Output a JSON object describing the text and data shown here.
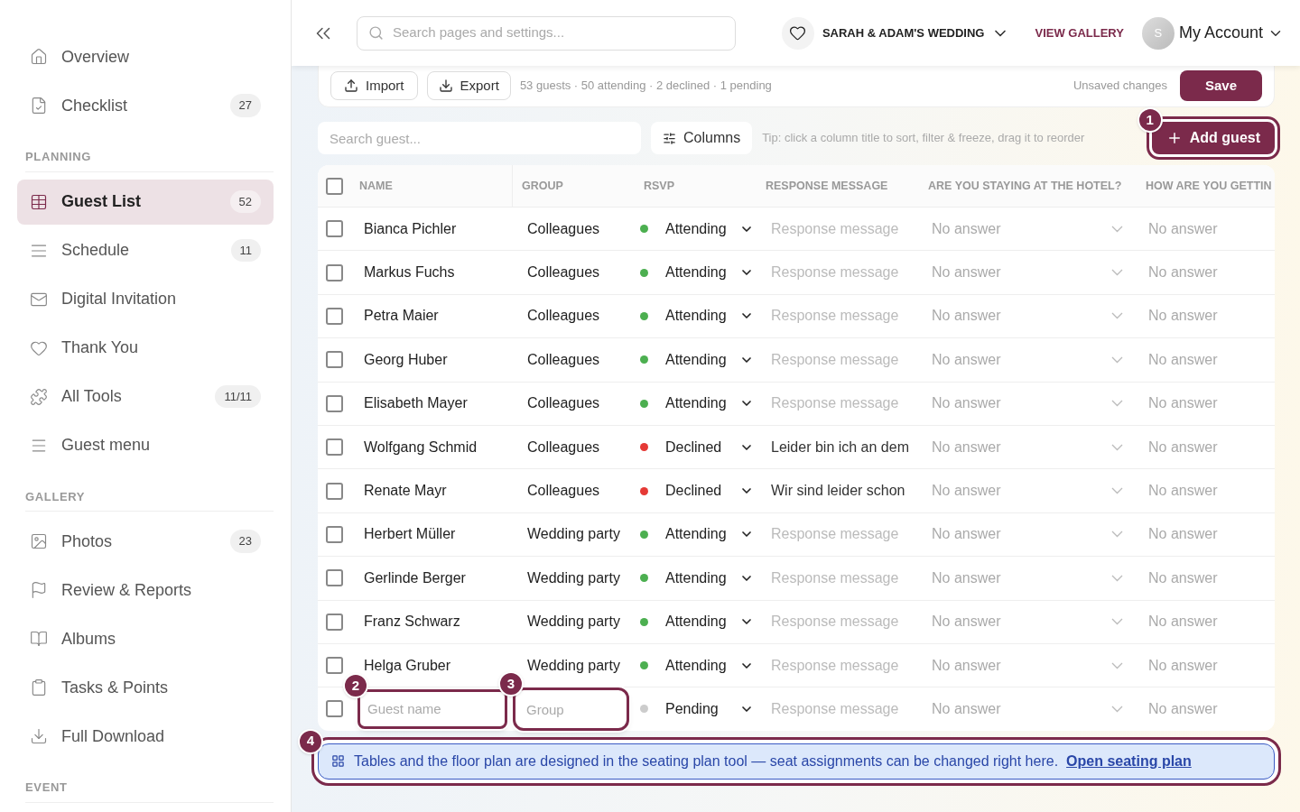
{
  "sidebar": {
    "sections": [
      {
        "items": [
          {
            "label": "Overview",
            "selected": false
          },
          {
            "label": "Checklist",
            "count": "27",
            "selected": false
          }
        ]
      },
      {
        "heading": "PLANNING",
        "items": [
          {
            "label": "Guest List",
            "count": "52",
            "selected": true
          },
          {
            "label": "Schedule",
            "count": "11",
            "selected": false
          },
          {
            "label": "Digital Invitation",
            "selected": false
          },
          {
            "label": "Thank You",
            "selected": false
          },
          {
            "label": "All Tools",
            "count": "11/11",
            "selected": false
          },
          {
            "label": "Guest menu",
            "selected": false
          }
        ]
      },
      {
        "heading": "GALLERY",
        "items": [
          {
            "label": "Photos",
            "count": "23",
            "selected": false
          },
          {
            "label": "Review & Reports",
            "selected": false
          },
          {
            "label": "Albums",
            "selected": false
          },
          {
            "label": "Tasks & Points",
            "selected": false
          },
          {
            "label": "Full Download",
            "selected": false
          }
        ]
      },
      {
        "heading": "EVENT"
      }
    ]
  },
  "header": {
    "search_placeholder": "Search pages and settings...",
    "event": "SARAH & ADAM'S WEDDING",
    "gallery_link": "VIEW GALLERY",
    "avatar": "S",
    "account": "My Account"
  },
  "toolbar": {
    "import": "Import",
    "export": "Export",
    "summary": "53 guests · 50 attending · 2 declined · 1 pending",
    "status": "Unsaved changes",
    "save": "Save"
  },
  "filter": {
    "search_placeholder": "Search guest...",
    "columns": "Columns",
    "tip": "Tip: click a column title to sort, filter & freeze, drag it to reorder",
    "add_guest": "Add guest",
    "callout": "1"
  },
  "table": {
    "select_all_checked": false,
    "columns": [
      "NAME",
      "GROUP",
      "RSVP",
      "RESPONSE MESSAGE",
      "ARE YOU STAYING AT THE HOTEL?",
      "HOW ARE YOU GETTIN"
    ],
    "rows": [
      {
        "checked": false,
        "name": "Bianca Pichler",
        "group": "Colleagues",
        "rsvp": "Attending",
        "color": "#4caf50",
        "response_placeholder": "Response message",
        "hotel": "No answer",
        "travel": "No answer"
      },
      {
        "checked": false,
        "name": "Markus Fuchs",
        "group": "Colleagues",
        "rsvp": "Attending",
        "color": "#4caf50",
        "response_placeholder": "Response message",
        "hotel": "No answer",
        "travel": "No answer"
      },
      {
        "checked": false,
        "name": "Petra Maier",
        "group": "Colleagues",
        "rsvp": "Attending",
        "color": "#4caf50",
        "response_placeholder": "Response message",
        "hotel": "No answer",
        "travel": "No answer"
      },
      {
        "checked": false,
        "name": "Georg Huber",
        "group": "Colleagues",
        "rsvp": "Attending",
        "color": "#4caf50",
        "response_placeholder": "Response message",
        "hotel": "No answer",
        "travel": "No answer"
      },
      {
        "checked": false,
        "name": "Elisabeth Mayer",
        "group": "Colleagues",
        "rsvp": "Attending",
        "color": "#4caf50",
        "response_placeholder": "Response message",
        "hotel": "No answer",
        "travel": "No answer"
      },
      {
        "checked": false,
        "name": "Wolfgang Schmid",
        "group": "Colleagues",
        "rsvp": "Declined",
        "color": "#e53935",
        "response": "Leider bin ich an dem",
        "hotel": "No answer",
        "travel": "No answer"
      },
      {
        "checked": false,
        "name": "Renate Mayr",
        "group": "Colleagues",
        "rsvp": "Declined",
        "color": "#e53935",
        "response": "Wir sind leider schon",
        "hotel": "No answer",
        "travel": "No answer"
      },
      {
        "checked": false,
        "name": "Herbert Müller",
        "group": "Wedding party",
        "rsvp": "Attending",
        "color": "#4caf50",
        "response_placeholder": "Response message",
        "hotel": "No answer",
        "travel": "No answer"
      },
      {
        "checked": false,
        "name": "Gerlinde Berger",
        "group": "Wedding party",
        "rsvp": "Attending",
        "color": "#4caf50",
        "response_placeholder": "Response message",
        "hotel": "No answer",
        "travel": "No answer"
      },
      {
        "checked": false,
        "name": "Franz Schwarz",
        "group": "Wedding party",
        "rsvp": "Attending",
        "color": "#4caf50",
        "response_placeholder": "Response message",
        "hotel": "No answer",
        "travel": "No answer"
      },
      {
        "checked": false,
        "name": "Helga Gruber",
        "group": "Wedding party",
        "rsvp": "Attending",
        "color": "#4caf50",
        "response_placeholder": "Response message",
        "hotel": "No answer",
        "travel": "No answer"
      }
    ],
    "new_row": {
      "checked": false,
      "name_placeholder": "Guest name",
      "name_callout": "2",
      "group_placeholder": "Group",
      "group_callout": "3",
      "rsvp": "Pending",
      "color": "#cccccc",
      "response_placeholder": "Response message",
      "hotel": "No answer",
      "travel": "No answer"
    }
  },
  "notice": {
    "callout": "4",
    "text": "Tables and the floor plan are designed in the seating plan tool — seat assignments can be changed right here.",
    "link": "Open seating plan"
  }
}
